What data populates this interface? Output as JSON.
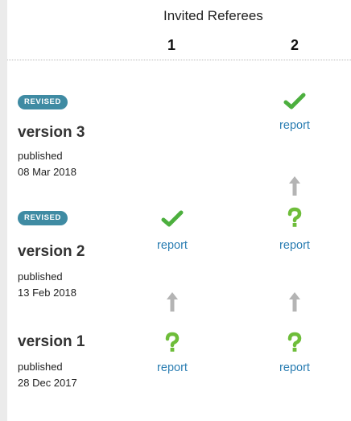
{
  "header": {
    "title": "Invited Referees",
    "referees": [
      "1",
      "2"
    ]
  },
  "colors": {
    "approved": "#4caf3e",
    "question": "#6ebd3a",
    "link": "#2a7db2",
    "badge": "#3f8ba3",
    "arrow": "#b4b4b4"
  },
  "versions": [
    {
      "badge": "REVISED",
      "title": "version 3",
      "published_label": "published",
      "date": "08 Mar 2018",
      "reviews": [
        null,
        {
          "status_icon": "check-icon",
          "link_label": "report"
        }
      ]
    },
    {
      "badge": "REVISED",
      "title": "version 2",
      "published_label": "published",
      "date": "13 Feb 2018",
      "reviews": [
        {
          "status_icon": "check-icon",
          "link_label": "report"
        },
        {
          "status_icon": "question-icon",
          "link_label": "report"
        }
      ]
    },
    {
      "title": "version 1",
      "published_label": "published",
      "date": "28 Dec 2017",
      "reviews": [
        {
          "status_icon": "question-icon",
          "link_label": "report"
        },
        {
          "status_icon": "question-icon",
          "link_label": "report"
        }
      ]
    }
  ]
}
